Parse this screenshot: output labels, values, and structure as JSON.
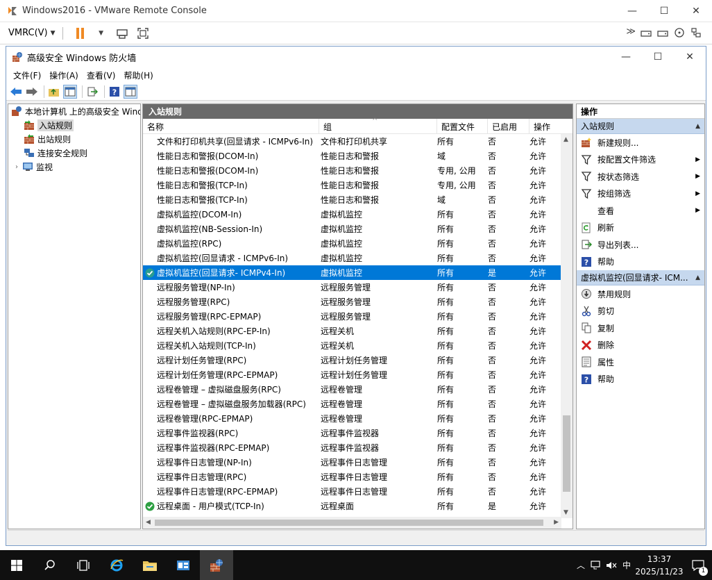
{
  "vmrc": {
    "title": "Windows2016 - VMware Remote Console",
    "menu_label": "VMRC(V)",
    "minimize": "—",
    "maximize": "☐",
    "close": "✕"
  },
  "mmc": {
    "title": "高级安全 Windows 防火墙",
    "minimize": "—",
    "maximize": "☐",
    "close": "✕",
    "menu": [
      "文件(F)",
      "操作(A)",
      "查看(V)",
      "帮助(H)"
    ]
  },
  "tree": {
    "root": "本地计算机 上的高级安全 Windows 防火墙",
    "items": [
      "入站规则",
      "出站规则",
      "连接安全规则",
      "监视"
    ],
    "selected": "入站规则"
  },
  "center": {
    "header": "入站规则",
    "columns": [
      "名称",
      "组",
      "配置文件",
      "已启用",
      "操作"
    ],
    "rows": [
      {
        "name": "文件和打印机共享(回显请求 - ICMPv6-In)",
        "group": "文件和打印机共享",
        "profile": "所有",
        "enabled": "否",
        "action": "允许",
        "icon": ""
      },
      {
        "name": "性能日志和警报(DCOM-In)",
        "group": "性能日志和警报",
        "profile": "域",
        "enabled": "否",
        "action": "允许",
        "icon": ""
      },
      {
        "name": "性能日志和警报(DCOM-In)",
        "group": "性能日志和警报",
        "profile": "专用, 公用",
        "enabled": "否",
        "action": "允许",
        "icon": ""
      },
      {
        "name": "性能日志和警报(TCP-In)",
        "group": "性能日志和警报",
        "profile": "专用, 公用",
        "enabled": "否",
        "action": "允许",
        "icon": ""
      },
      {
        "name": "性能日志和警报(TCP-In)",
        "group": "性能日志和警报",
        "profile": "域",
        "enabled": "否",
        "action": "允许",
        "icon": ""
      },
      {
        "name": "虚拟机监控(DCOM-In)",
        "group": "虚拟机监控",
        "profile": "所有",
        "enabled": "否",
        "action": "允许",
        "icon": ""
      },
      {
        "name": "虚拟机监控(NB-Session-In)",
        "group": "虚拟机监控",
        "profile": "所有",
        "enabled": "否",
        "action": "允许",
        "icon": ""
      },
      {
        "name": "虚拟机监控(RPC)",
        "group": "虚拟机监控",
        "profile": "所有",
        "enabled": "否",
        "action": "允许",
        "icon": ""
      },
      {
        "name": "虚拟机监控(回显请求 - ICMPv6-In)",
        "group": "虚拟机监控",
        "profile": "所有",
        "enabled": "否",
        "action": "允许",
        "icon": ""
      },
      {
        "name": "虚拟机监控(回显请求- ICMPv4-In)",
        "group": "虚拟机监控",
        "profile": "所有",
        "enabled": "是",
        "action": "允许",
        "icon": "check",
        "selected": true
      },
      {
        "name": "远程服务管理(NP-In)",
        "group": "远程服务管理",
        "profile": "所有",
        "enabled": "否",
        "action": "允许",
        "icon": ""
      },
      {
        "name": "远程服务管理(RPC)",
        "group": "远程服务管理",
        "profile": "所有",
        "enabled": "否",
        "action": "允许",
        "icon": ""
      },
      {
        "name": "远程服务管理(RPC-EPMAP)",
        "group": "远程服务管理",
        "profile": "所有",
        "enabled": "否",
        "action": "允许",
        "icon": ""
      },
      {
        "name": "远程关机入站规则(RPC-EP-In)",
        "group": "远程关机",
        "profile": "所有",
        "enabled": "否",
        "action": "允许",
        "icon": ""
      },
      {
        "name": "远程关机入站规则(TCP-In)",
        "group": "远程关机",
        "profile": "所有",
        "enabled": "否",
        "action": "允许",
        "icon": ""
      },
      {
        "name": "远程计划任务管理(RPC)",
        "group": "远程计划任务管理",
        "profile": "所有",
        "enabled": "否",
        "action": "允许",
        "icon": ""
      },
      {
        "name": "远程计划任务管理(RPC-EPMAP)",
        "group": "远程计划任务管理",
        "profile": "所有",
        "enabled": "否",
        "action": "允许",
        "icon": ""
      },
      {
        "name": "远程卷管理 – 虚拟磁盘服务(RPC)",
        "group": "远程卷管理",
        "profile": "所有",
        "enabled": "否",
        "action": "允许",
        "icon": ""
      },
      {
        "name": "远程卷管理 – 虚拟磁盘服务加载器(RPC)",
        "group": "远程卷管理",
        "profile": "所有",
        "enabled": "否",
        "action": "允许",
        "icon": ""
      },
      {
        "name": "远程卷管理(RPC-EPMAP)",
        "group": "远程卷管理",
        "profile": "所有",
        "enabled": "否",
        "action": "允许",
        "icon": ""
      },
      {
        "name": "远程事件监视器(RPC)",
        "group": "远程事件监视器",
        "profile": "所有",
        "enabled": "否",
        "action": "允许",
        "icon": ""
      },
      {
        "name": "远程事件监视器(RPC-EPMAP)",
        "group": "远程事件监视器",
        "profile": "所有",
        "enabled": "否",
        "action": "允许",
        "icon": ""
      },
      {
        "name": "远程事件日志管理(NP-In)",
        "group": "远程事件日志管理",
        "profile": "所有",
        "enabled": "否",
        "action": "允许",
        "icon": ""
      },
      {
        "name": "远程事件日志管理(RPC)",
        "group": "远程事件日志管理",
        "profile": "所有",
        "enabled": "否",
        "action": "允许",
        "icon": ""
      },
      {
        "name": "远程事件日志管理(RPC-EPMAP)",
        "group": "远程事件日志管理",
        "profile": "所有",
        "enabled": "否",
        "action": "允许",
        "icon": ""
      },
      {
        "name": "远程桌面 - 用户模式(TCP-In)",
        "group": "远程桌面",
        "profile": "所有",
        "enabled": "是",
        "action": "允许",
        "icon": "check"
      }
    ]
  },
  "actions": {
    "title": "操作",
    "section1": "入站规则",
    "items1": [
      {
        "label": "新建规则...",
        "icon": "new-rule-icon",
        "sub": false
      },
      {
        "label": "按配置文件筛选",
        "icon": "filter-icon",
        "sub": true
      },
      {
        "label": "按状态筛选",
        "icon": "filter-icon",
        "sub": true
      },
      {
        "label": "按组筛选",
        "icon": "filter-icon",
        "sub": true
      },
      {
        "label": "查看",
        "icon": "",
        "sub": true
      },
      {
        "label": "刷新",
        "icon": "refresh-icon",
        "sub": false
      },
      {
        "label": "导出列表...",
        "icon": "export-icon",
        "sub": false
      },
      {
        "label": "帮助",
        "icon": "help-icon",
        "sub": false
      }
    ],
    "section2": "虚拟机监控(回显请求- ICM...",
    "items2": [
      {
        "label": "禁用规则",
        "icon": "disable-icon"
      },
      {
        "label": "剪切",
        "icon": "cut-icon"
      },
      {
        "label": "复制",
        "icon": "copy-icon"
      },
      {
        "label": "删除",
        "icon": "delete-icon"
      },
      {
        "label": "属性",
        "icon": "properties-icon"
      },
      {
        "label": "帮助",
        "icon": "help-icon"
      }
    ]
  },
  "taskbar": {
    "time": "13:37",
    "date": "2025/11/23",
    "ime": "中",
    "notification_count": "1"
  },
  "colors": {
    "selection": "#0078d7",
    "section_bg": "#c6d8ee",
    "header_bg": "#6a6a6a"
  }
}
